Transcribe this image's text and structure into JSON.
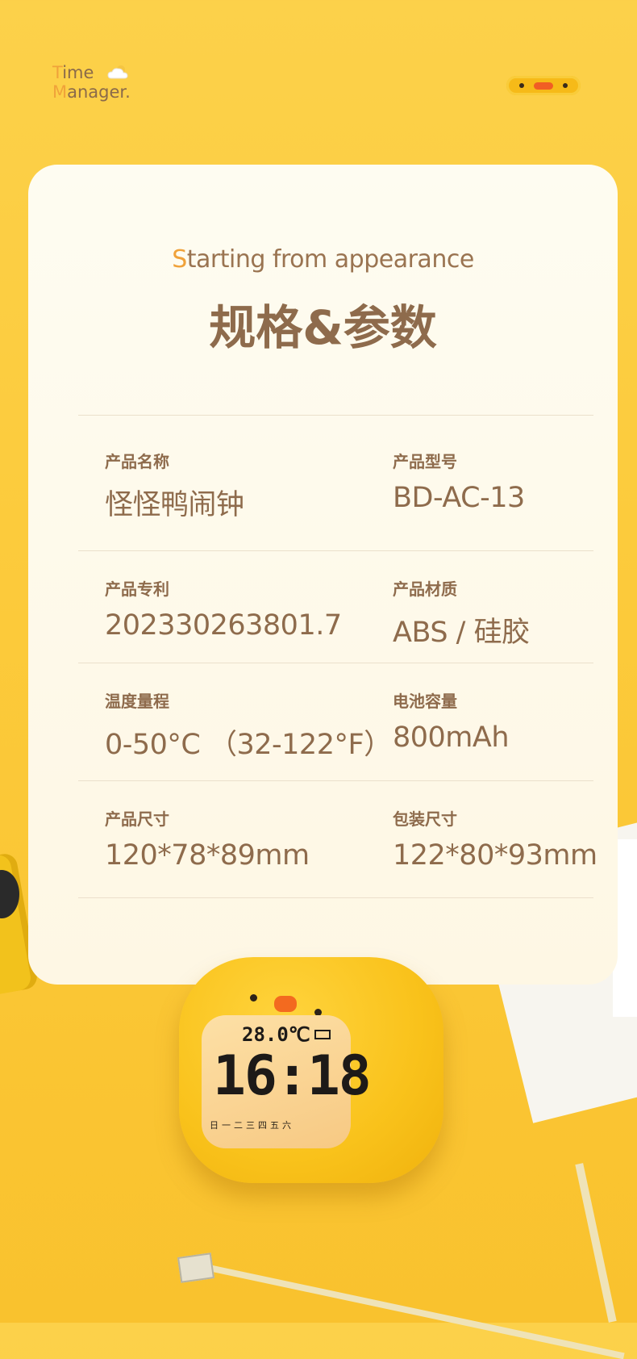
{
  "brand": {
    "line1": "Time",
    "line2": "Manager."
  },
  "card": {
    "eyebrow": "Starting from appearance",
    "title": "规格&参数",
    "specs": [
      {
        "label": "产品名称",
        "value": "怪怪鸭闹钟"
      },
      {
        "label": "产品型号",
        "value": "BD-AC-13"
      },
      {
        "label": "产品专利",
        "value": "202330263801.7"
      },
      {
        "label": "产品材质",
        "value": "ABS / 硅胶"
      },
      {
        "label": "温度量程",
        "value": "0-50°C （32-122°F）"
      },
      {
        "label": "电池容量",
        "value": "800mAh"
      },
      {
        "label": "产品尺寸",
        "value": "120*78*89mm"
      },
      {
        "label": "包装尺寸",
        "value": "122*80*93mm"
      }
    ]
  },
  "clock_display": {
    "temperature": "28.0℃",
    "time": "16:18",
    "weekdays": "日一二三四五六"
  },
  "colors": {
    "background": "#fcd14a",
    "card": "#fefcf1",
    "text": "#8e6b4c",
    "accent": "#f0a23a"
  }
}
